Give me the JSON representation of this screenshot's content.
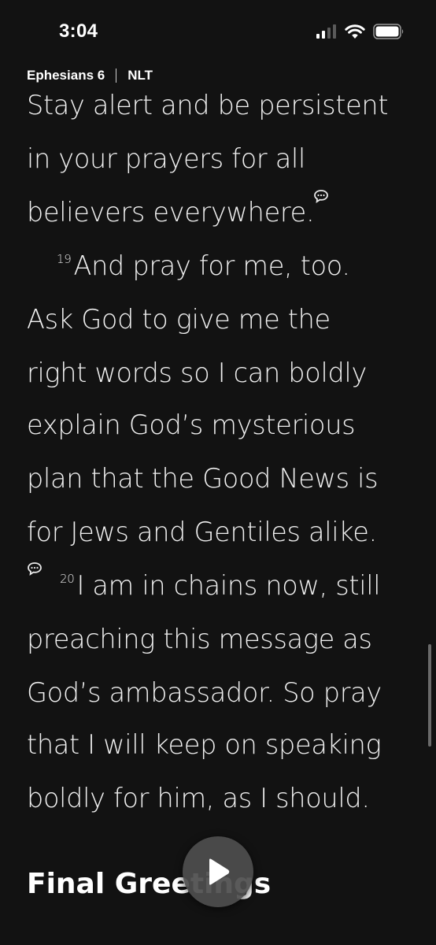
{
  "status_bar": {
    "time": "3:04"
  },
  "header": {
    "book_chapter": "Ephesians 6",
    "translation": "NLT"
  },
  "passage": {
    "lines": [
      "Stay alert and be persistent",
      "in your prayers for all",
      "believers everywhere.",
      "And pray for me, too.",
      "Ask God to give me the",
      "right words so I can boldly",
      "explain God’s mysterious",
      "plan that the Good News is",
      "for Jews and Gentiles alike.",
      "I am in chains now, still",
      "preaching this message as",
      "God’s ambassador. So pray",
      "that I will keep on speaking",
      "boldly for him, as I should."
    ],
    "verse_19": "19",
    "verse_20": "20"
  },
  "section_heading": "Final Greetings",
  "icons": {
    "note": "speech-bubble-icon",
    "play": "play-icon",
    "signal": "cellular-signal-icon",
    "wifi": "wifi-icon",
    "battery": "battery-icon"
  }
}
